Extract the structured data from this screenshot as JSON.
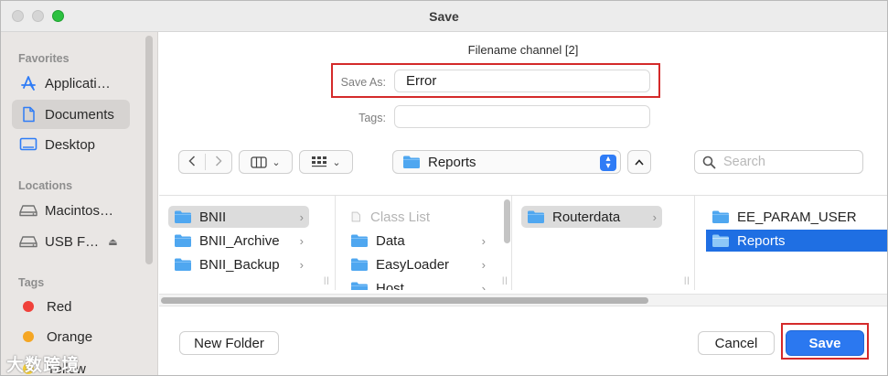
{
  "window": {
    "title": "Save"
  },
  "sidebar": {
    "favorites_header": "Favorites",
    "favorites": [
      {
        "label": "Applicati…",
        "icon": "app-store-icon"
      },
      {
        "label": "Documents",
        "icon": "document-icon",
        "selected": true
      },
      {
        "label": "Desktop",
        "icon": "desktop-icon"
      }
    ],
    "locations_header": "Locations",
    "locations": [
      {
        "label": "Macintos…",
        "icon": "drive-icon"
      },
      {
        "label": "USB F…",
        "icon": "drive-icon",
        "eject": "⏏"
      }
    ],
    "tags_header": "Tags",
    "tags": [
      {
        "label": "Red",
        "color": "#f0413a"
      },
      {
        "label": "Orange",
        "color": "#f5a623"
      },
      {
        "label": "Yellow",
        "color": "#f7cf2e"
      }
    ]
  },
  "dialog": {
    "heading": "Filename channel [2]",
    "save_as_label": "Save As:",
    "save_as_value": "Error",
    "tags_label": "Tags:",
    "tags_value": ""
  },
  "toolbar": {
    "location": "Reports",
    "search_placeholder": "Search"
  },
  "browser": {
    "column1": [
      {
        "label": "BNII",
        "selected": "gray",
        "chevron": true
      },
      {
        "label": "BNII_Archive",
        "chevron": true
      },
      {
        "label": "BNII_Backup",
        "chevron": true
      }
    ],
    "column2": [
      {
        "label": "Class List",
        "dim": true
      },
      {
        "label": "Data",
        "chevron": true
      },
      {
        "label": "EasyLoader",
        "chevron": true
      },
      {
        "label": "Host",
        "chevron": true
      }
    ],
    "column3": [
      {
        "label": "Routerdata",
        "selected": "gray",
        "chevron": true
      }
    ],
    "column4": [
      {
        "label": "EE_PARAM_USER"
      },
      {
        "label": "Reports",
        "selected": "blue"
      }
    ]
  },
  "buttons": {
    "new_folder": "New Folder",
    "cancel": "Cancel",
    "save": "Save"
  },
  "watermark": "大数跨境",
  "colors": {
    "accent_blue": "#2b78f0",
    "highlight_red": "#d42a2a",
    "folder_blue": "#4fa7f0"
  }
}
